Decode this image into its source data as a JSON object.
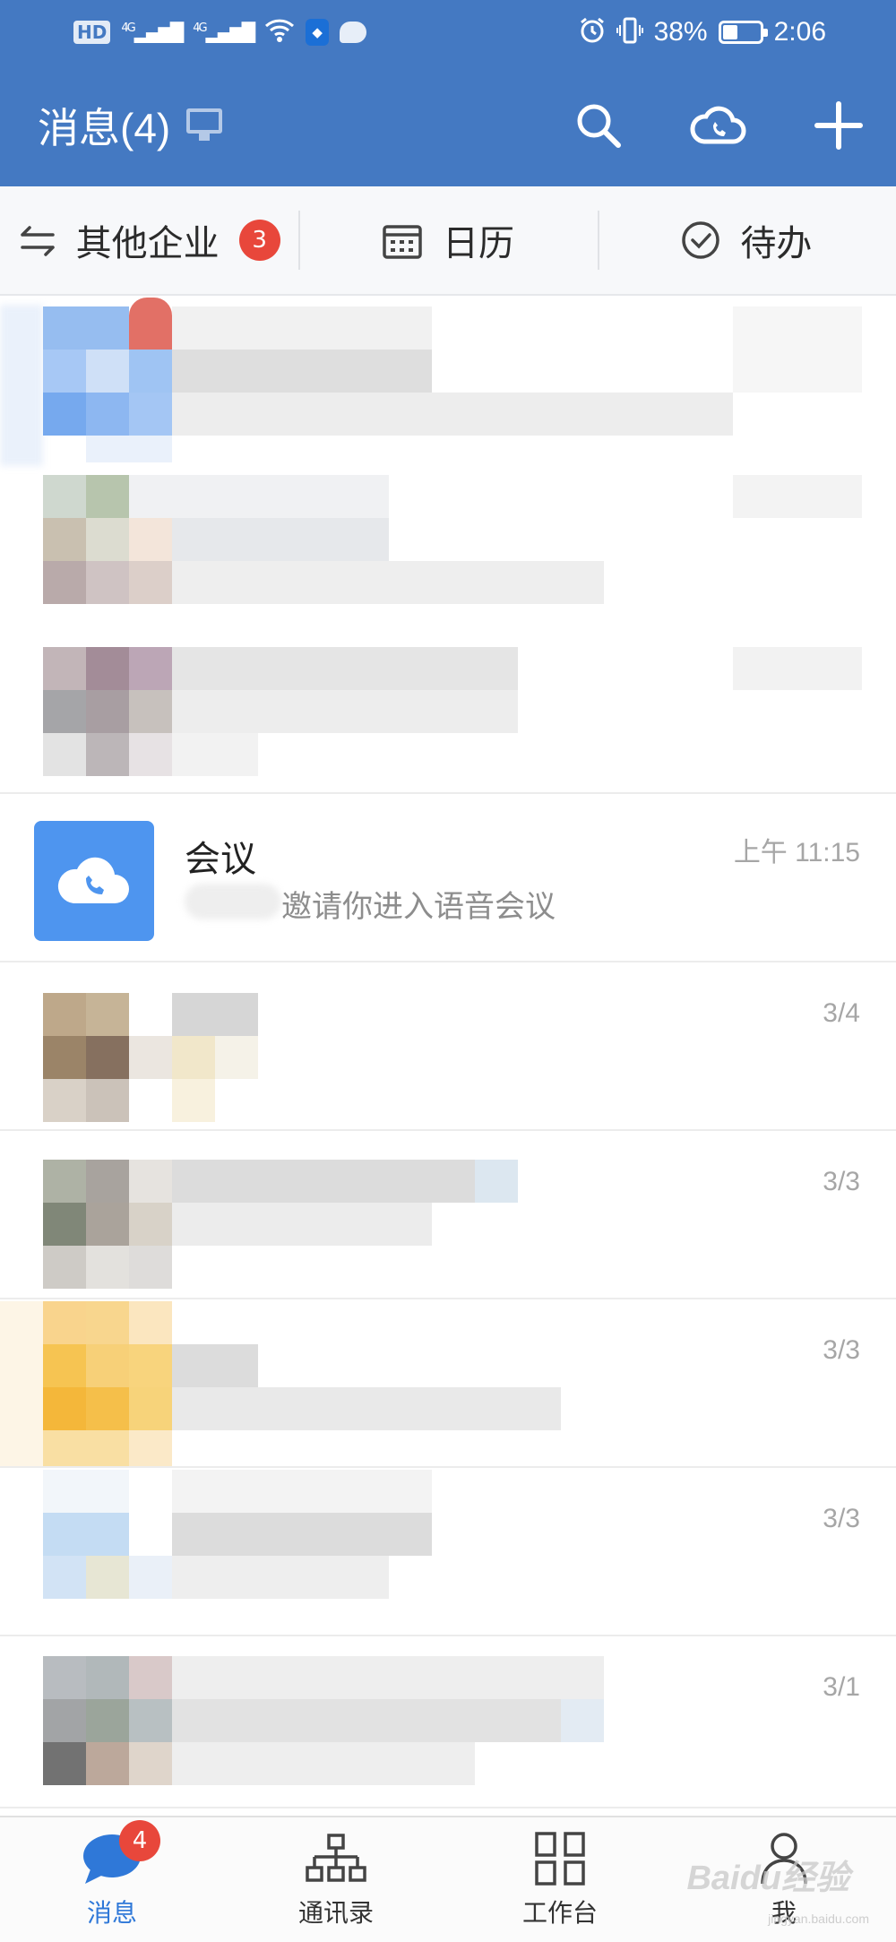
{
  "status_bar": {
    "hd": "HD",
    "signal": "4G",
    "battery_level": 0.38,
    "battery": "38%",
    "time": "2:06"
  },
  "header": {
    "title": "消息(4)",
    "icons": [
      "desktop-icon",
      "search-icon",
      "cloud-phone-icon",
      "plus-icon"
    ]
  },
  "shortcuts": [
    {
      "label": "其他企业",
      "badge": "3",
      "icon": "switch-arrows-icon"
    },
    {
      "label": "日历",
      "icon": "calendar-icon"
    },
    {
      "label": "待办",
      "icon": "check-circle-icon"
    }
  ],
  "messages": [
    {
      "title": "会议",
      "time": "上午 11:15",
      "preview": "邀请你进入语音会议"
    },
    {
      "time": "3/4"
    },
    {
      "time": "3/3"
    },
    {
      "time": "3/3"
    },
    {
      "time": "3/3"
    },
    {
      "time": "3/1"
    }
  ],
  "bottom_nav": [
    {
      "label": "消息",
      "badge": "4",
      "icon": "chat-bubble-icon",
      "active": true
    },
    {
      "label": "通讯录",
      "icon": "org-chart-icon"
    },
    {
      "label": "工作台",
      "icon": "grid-icon"
    },
    {
      "label": "我",
      "icon": "person-icon"
    }
  ],
  "watermark": {
    "text": "Baidu经验",
    "sub": "jingyan.baidu.com"
  },
  "colors": {
    "primary": "#4479c2",
    "badge": "#e8473b",
    "active_nav": "#2f78d8",
    "meeting_avatar": "#4e95ef"
  }
}
